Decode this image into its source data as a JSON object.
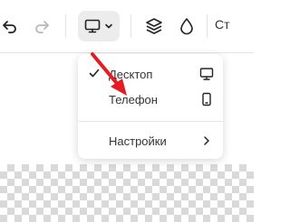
{
  "toolbar": {
    "icons": [
      "undo-icon",
      "redo-icon",
      "monitor-icon",
      "chevron-down-icon",
      "layers-icon",
      "drop-icon"
    ],
    "truncated_text": "Ст"
  },
  "device_menu": {
    "items": [
      {
        "label": "Десктоп",
        "checked": true,
        "icon": "monitor-icon"
      },
      {
        "label": "Телефон",
        "checked": false,
        "icon": "phone-icon"
      },
      {
        "label": "Настройки",
        "submenu": true,
        "icon": "chevron-right-icon"
      }
    ]
  },
  "annotation": {
    "arrow_color": "#e51c23"
  },
  "colors": {
    "active_button_bg": "#ececec",
    "text": "#333333",
    "menu_bg": "#ffffff"
  }
}
